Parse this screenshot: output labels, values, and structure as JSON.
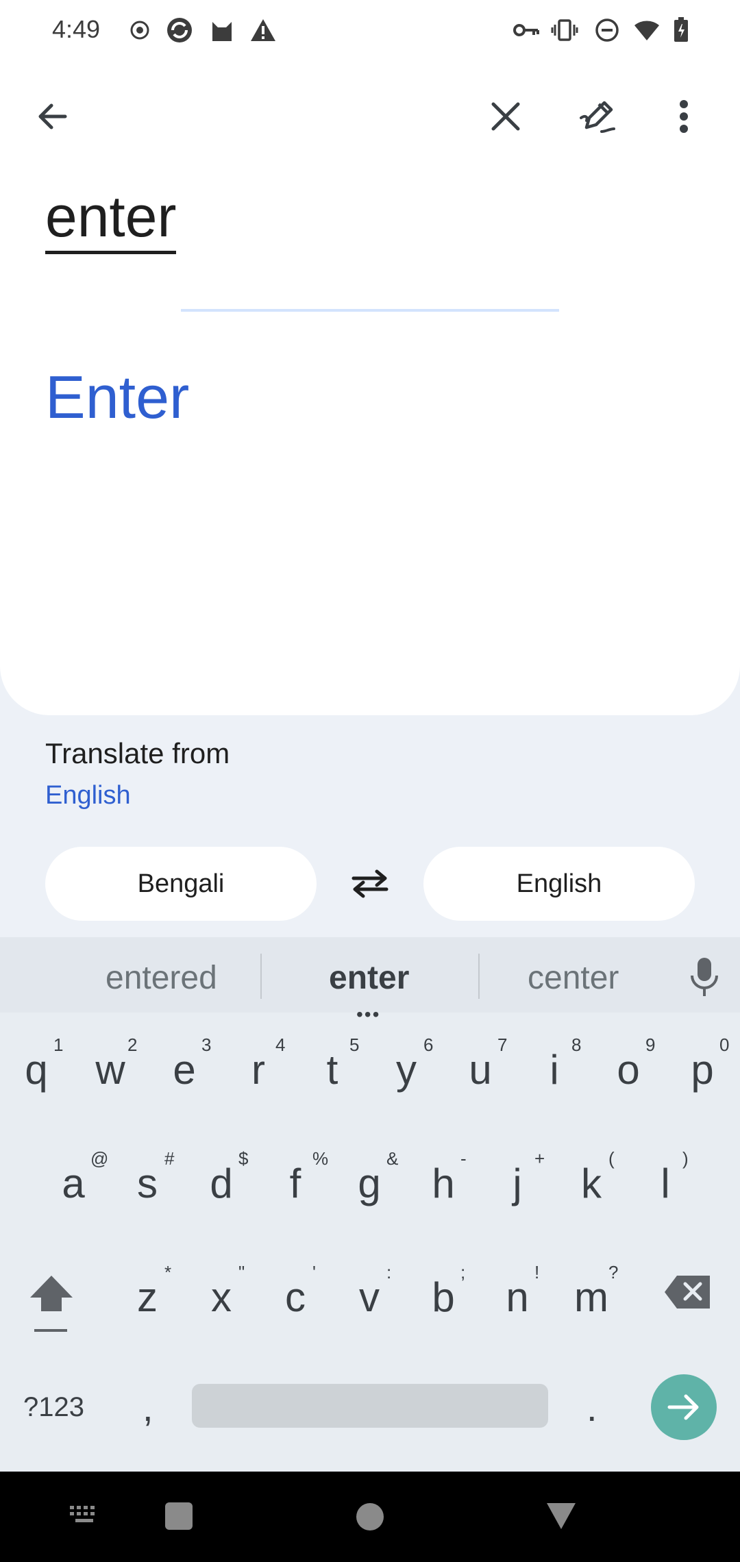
{
  "status_bar": {
    "time": "4:49"
  },
  "toolbar": {
    "back_icon": "arrow-left-icon",
    "clear_icon": "close-icon",
    "handwriting_icon": "handwriting-pen-icon",
    "more_icon": "more-vert-icon"
  },
  "source_text": "enter",
  "translation_text": "Enter",
  "translate_from": {
    "label": "Translate from",
    "value": "English"
  },
  "languages": {
    "left": "Bengali",
    "right": "English"
  },
  "keyboard": {
    "suggestions": [
      "entered",
      "enter",
      "center"
    ],
    "row1": [
      {
        "k": "q",
        "h": "1"
      },
      {
        "k": "w",
        "h": "2"
      },
      {
        "k": "e",
        "h": "3"
      },
      {
        "k": "r",
        "h": "4"
      },
      {
        "k": "t",
        "h": "5"
      },
      {
        "k": "y",
        "h": "6"
      },
      {
        "k": "u",
        "h": "7"
      },
      {
        "k": "i",
        "h": "8"
      },
      {
        "k": "o",
        "h": "9"
      },
      {
        "k": "p",
        "h": "0"
      }
    ],
    "row2": [
      {
        "k": "a",
        "h": "@"
      },
      {
        "k": "s",
        "h": "#"
      },
      {
        "k": "d",
        "h": "$"
      },
      {
        "k": "f",
        "h": "%"
      },
      {
        "k": "g",
        "h": "&"
      },
      {
        "k": "h",
        "h": "-"
      },
      {
        "k": "j",
        "h": "+"
      },
      {
        "k": "k",
        "h": "("
      },
      {
        "k": "l",
        "h": ")"
      }
    ],
    "row3": [
      {
        "k": "z",
        "h": "*"
      },
      {
        "k": "x",
        "h": "\""
      },
      {
        "k": "c",
        "h": "'"
      },
      {
        "k": "v",
        "h": ":"
      },
      {
        "k": "b",
        "h": ";"
      },
      {
        "k": "n",
        "h": "!"
      },
      {
        "k": "m",
        "h": "?"
      }
    ],
    "symbols_label": "?123",
    "comma": ",",
    "period": ".",
    "colors": {
      "enter_key": "#5fb3a8",
      "accent_blue": "#2f5fd0"
    }
  }
}
